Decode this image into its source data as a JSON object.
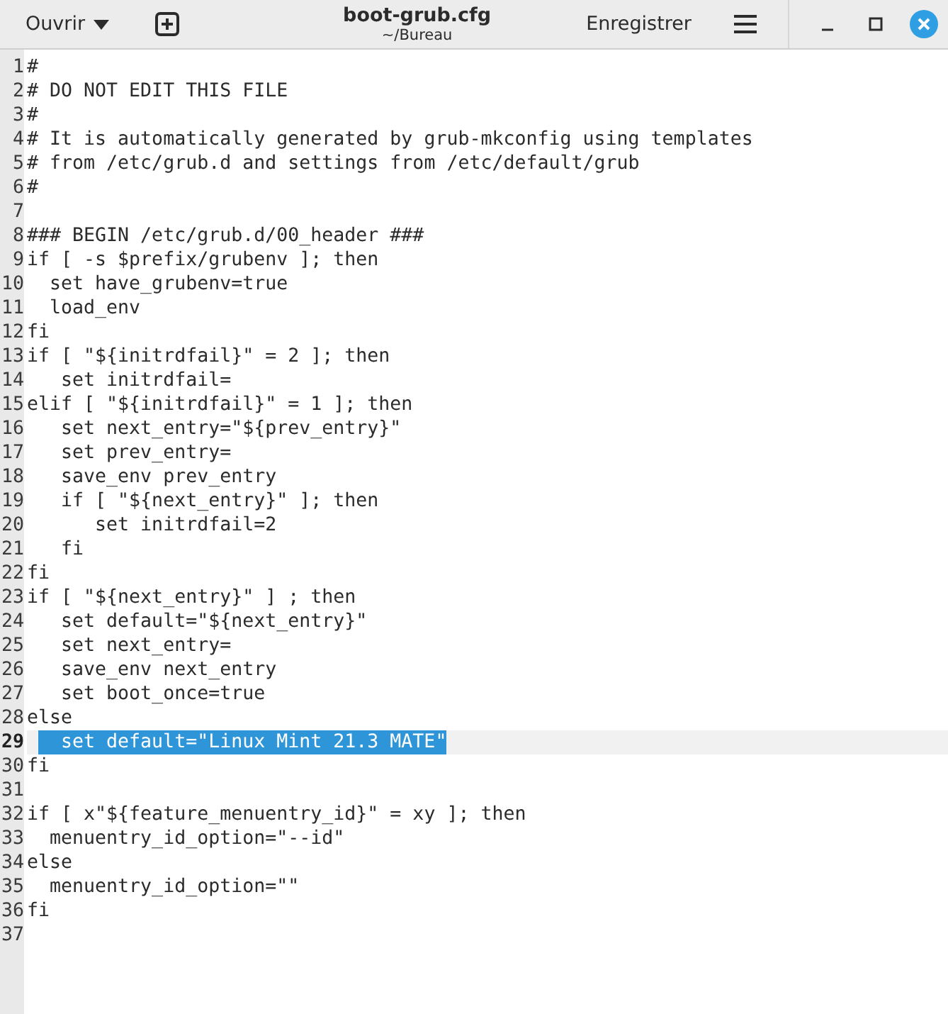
{
  "header": {
    "open_button": "Ouvrir",
    "title": "boot-grub.cfg",
    "subtitle": "~/Bureau",
    "save_button": "Enregistrer"
  },
  "lines": [
    {
      "number": "1",
      "text": "#"
    },
    {
      "number": "2",
      "text": "# DO NOT EDIT THIS FILE"
    },
    {
      "number": "3",
      "text": "#"
    },
    {
      "number": "4",
      "text": "# It is automatically generated by grub-mkconfig using templates"
    },
    {
      "number": "5",
      "text": "# from /etc/grub.d and settings from /etc/default/grub"
    },
    {
      "number": "6",
      "text": "#"
    },
    {
      "number": "7"
    },
    {
      "number": "8",
      "text": "### BEGIN /etc/grub.d/00_header ###"
    },
    {
      "number": "9",
      "text": "if [ -s $prefix/grubenv ]; then"
    },
    {
      "number": "10",
      "text": "  set have_grubenv=true"
    },
    {
      "number": "11",
      "text": "  load_env"
    },
    {
      "number": "12",
      "text": "fi"
    },
    {
      "number": "13",
      "text": "if [ \"${initrdfail}\" = 2 ]; then"
    },
    {
      "number": "14",
      "text": "   set initrdfail="
    },
    {
      "number": "15",
      "text": "elif [ \"${initrdfail}\" = 1 ]; then"
    },
    {
      "number": "16",
      "text": "   set next_entry=\"${prev_entry}\""
    },
    {
      "number": "17",
      "text": "   set prev_entry="
    },
    {
      "number": "18",
      "text": "   save_env prev_entry"
    },
    {
      "number": "19",
      "text": "   if [ \"${next_entry}\" ]; then"
    },
    {
      "number": "20",
      "text": "      set initrdfail=2"
    },
    {
      "number": "21",
      "text": "   fi"
    },
    {
      "number": "22",
      "text": "fi"
    },
    {
      "number": "23",
      "text": "if [ \"${next_entry}\" ] ; then"
    },
    {
      "number": "24",
      "text": "   set default=\"${next_entry}\""
    },
    {
      "number": "25",
      "text": "   set next_entry="
    },
    {
      "number": "26",
      "text": "   save_env next_entry"
    },
    {
      "number": "27",
      "text": "   set boot_once=true"
    },
    {
      "number": "28",
      "text": "else"
    },
    {
      "number": "29",
      "selected_text": "  set default=\"Linux Mint 21.3 MATE\"",
      "current": true
    },
    {
      "number": "30",
      "text": "fi"
    },
    {
      "number": "31"
    },
    {
      "number": "32",
      "text": "if [ x\"${feature_menuentry_id}\" = xy ]; then"
    },
    {
      "number": "33",
      "text": "  menuentry_id_option=\"--id\""
    },
    {
      "number": "34",
      "text": "else"
    },
    {
      "number": "35",
      "text": "  menuentry_id_option=\"\""
    },
    {
      "number": "36",
      "text": "fi"
    },
    {
      "number": "37"
    }
  ]
}
